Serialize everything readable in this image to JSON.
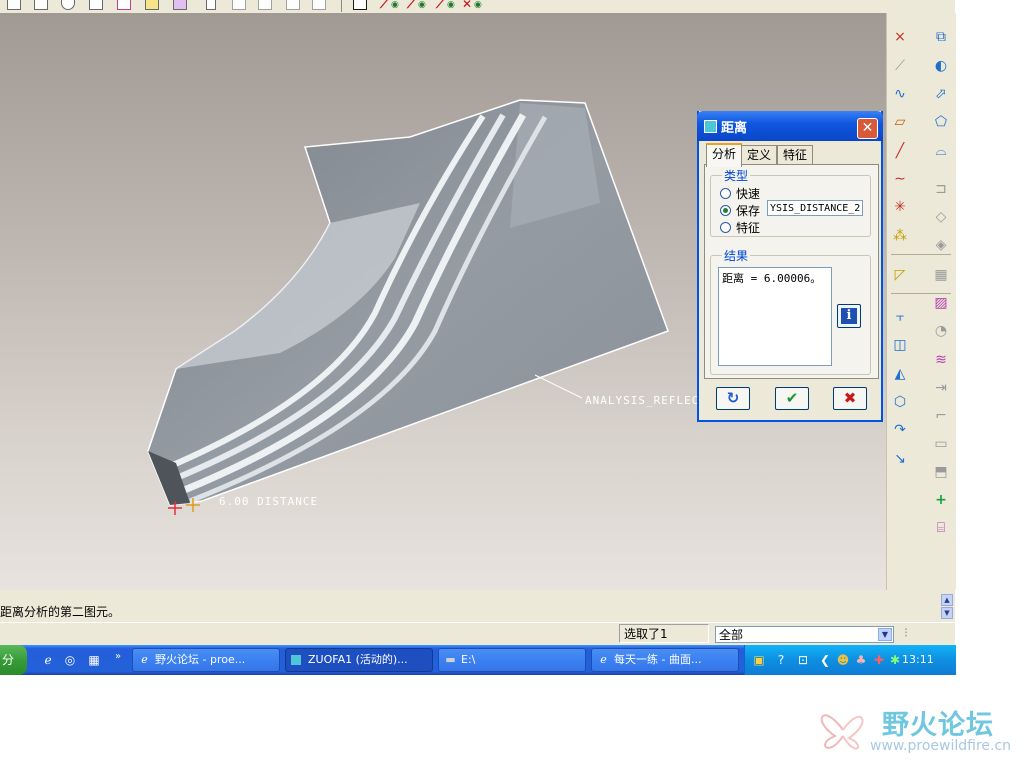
{
  "viewport": {
    "reflect_label": "ANALYSIS_REFLEC",
    "distance_label": "6.00  DISTANCE",
    "colors": {
      "surface": "#8e949b",
      "highlight": "#e8ecf0",
      "background_top": "#a19a94",
      "background_bottom": "#e8e3de"
    }
  },
  "top_toolbar": {
    "icons": [
      "new-file-icon",
      "open-icon",
      "save-icon",
      "print-icon",
      "window-icon",
      "datum-plane-icon",
      "repaint-icon",
      "undo-icon",
      "redo-icon",
      "cut-icon",
      "copy-icon",
      "paste-icon",
      "cancel-icon",
      "axis-display-icon",
      "point-display-icon",
      "csys-display-icon",
      "datum-tag-icon"
    ]
  },
  "right_toolbar": {
    "icons": [
      "datum-point-icon",
      "datum-csys-icon",
      "datum-axis-icon",
      "datum-plane-icon",
      "sketch-icon",
      "curve-icon",
      "extrude-icon",
      "revolve-icon",
      "sweep-icon",
      "blend-icon",
      "round-icon",
      "chamfer-icon",
      "hole-icon",
      "shell-icon",
      "rib-icon",
      "draft-icon",
      "pattern-icon",
      "mirror-icon",
      "offset-icon",
      "thicken-icon"
    ]
  },
  "dialog": {
    "title": "距离",
    "close_symbol": "✕",
    "tabs": [
      "分析",
      "定义",
      "特征"
    ],
    "type_group": {
      "title": "类型",
      "options": [
        {
          "label": "快速",
          "selected": false
        },
        {
          "label": "保存",
          "selected": true
        },
        {
          "label": "特征",
          "selected": false
        }
      ],
      "name_value": "YSIS_DISTANCE_2"
    },
    "result_group": {
      "title": "结果",
      "text": "距离 = 6.00006。"
    },
    "info_symbol": "i",
    "buttons": {
      "repeat_symbol": "↻",
      "ok_symbol": "✔",
      "cancel_symbol": "✖"
    }
  },
  "status": {
    "message": "距离分析的第二图元。"
  },
  "selection_bar": {
    "count_text": "选取了1",
    "filter_value": "全部",
    "filter_arrow": "▼"
  },
  "taskbar": {
    "start_label": "分",
    "quick_launch": [
      "ie-icon",
      "ie-alt-icon",
      "media-icon",
      "»"
    ],
    "tasks": [
      {
        "label": "野火论坛 - proe...",
        "active": false
      },
      {
        "label": "ZUOFA1 (活动的)...",
        "active": true
      },
      {
        "label": "E:\\",
        "active": false
      },
      {
        "label": "每天一练 - 曲面...",
        "active": false
      }
    ],
    "clock": "13:11"
  },
  "watermark": {
    "text": "野火论坛",
    "url": "www.proewildfire.cn"
  }
}
